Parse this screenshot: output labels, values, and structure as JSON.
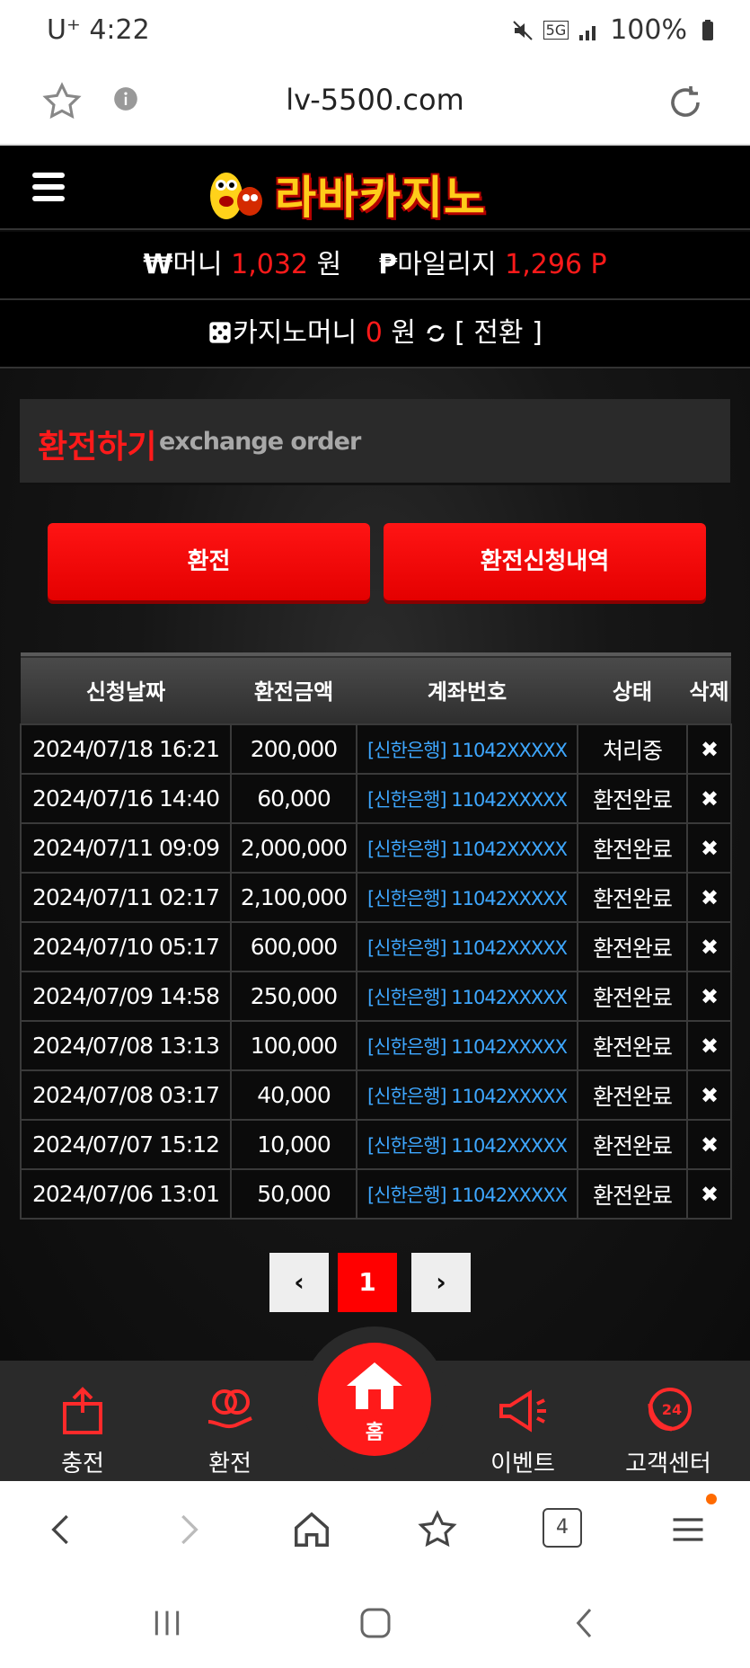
{
  "status_bar": {
    "carrier": "U⁺ 4:22",
    "battery": "100%",
    "network": "5G"
  },
  "browser": {
    "url": "lv-5500.com"
  },
  "header": {
    "logo_text": "라바카지노"
  },
  "balance": {
    "money_label": "머니",
    "money_value": "1,032",
    "money_unit": "원",
    "mileage_label": "마일리지",
    "mileage_value": "1,296 P",
    "casino_label": "카지노머니",
    "casino_value": "0",
    "casino_unit": "원",
    "convert_label": "[ 전환 ]"
  },
  "section": {
    "title_ko": "환전하기",
    "title_en": "exchange order"
  },
  "buttons": {
    "exchange": "환전",
    "history": "환전신청내역"
  },
  "table": {
    "headers": [
      "신청날짜",
      "환전금액",
      "계좌번호",
      "상태",
      "삭제"
    ],
    "rows": [
      {
        "date": "2024/07/18 16:21",
        "amount": "200,000",
        "account": "[신한은행] 11042XXXXX",
        "status": "처리중",
        "delete": "✖"
      },
      {
        "date": "2024/07/16 14:40",
        "amount": "60,000",
        "account": "[신한은행] 11042XXXXX",
        "status": "환전완료",
        "delete": "✖"
      },
      {
        "date": "2024/07/11 09:09",
        "amount": "2,000,000",
        "account": "[신한은행] 11042XXXXX",
        "status": "환전완료",
        "delete": "✖"
      },
      {
        "date": "2024/07/11 02:17",
        "amount": "2,100,000",
        "account": "[신한은행] 11042XXXXX",
        "status": "환전완료",
        "delete": "✖"
      },
      {
        "date": "2024/07/10 05:17",
        "amount": "600,000",
        "account": "[신한은행] 11042XXXXX",
        "status": "환전완료",
        "delete": "✖"
      },
      {
        "date": "2024/07/09 14:58",
        "amount": "250,000",
        "account": "[신한은행] 11042XXXXX",
        "status": "환전완료",
        "delete": "✖"
      },
      {
        "date": "2024/07/08 13:13",
        "amount": "100,000",
        "account": "[신한은행] 11042XXXXX",
        "status": "환전완료",
        "delete": "✖"
      },
      {
        "date": "2024/07/08 03:17",
        "amount": "40,000",
        "account": "[신한은행] 11042XXXXX",
        "status": "환전완료",
        "delete": "✖"
      },
      {
        "date": "2024/07/07 15:12",
        "amount": "10,000",
        "account": "[신한은행] 11042XXXXX",
        "status": "환전완료",
        "delete": "✖"
      },
      {
        "date": "2024/07/06 13:01",
        "amount": "50,000",
        "account": "[신한은행] 11042XXXXX",
        "status": "환전완료",
        "delete": "✖"
      }
    ]
  },
  "pagination": {
    "prev": "‹",
    "current": "1",
    "next": "›"
  },
  "bottom_nav": {
    "charge": "충전",
    "exchange": "환전",
    "home": "홈",
    "event": "이벤트",
    "support": "고객센터",
    "support_badge": "24"
  },
  "browser_toolbar": {
    "tabs_count": "4"
  },
  "colors": {
    "accent": "#ff1a1a",
    "link": "#3ea7ff",
    "background": "#0b0b0b"
  }
}
